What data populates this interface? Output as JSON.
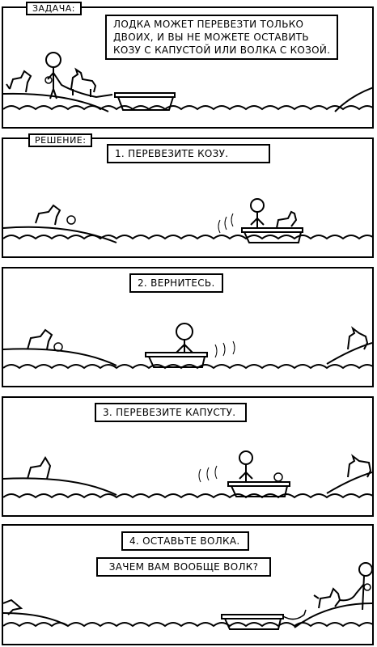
{
  "panels": [
    {
      "label": "ЗАДАЧА:",
      "caption_lines": [
        "ЛОДКА МОЖЕТ ПЕРЕВЕЗТИ ТОЛЬКО",
        "ДВОИХ, И ВЫ НЕ МОЖЕТЕ ОСТАВИТЬ",
        "КОЗУ С КАПУСТОЙ ИЛИ ВОЛКА С КОЗОЙ."
      ]
    },
    {
      "label": "РЕШЕНИЕ:",
      "caption": "1. ПЕРЕВЕЗИТЕ КОЗУ."
    },
    {
      "caption": "2. ВЕРНИТЕСЬ."
    },
    {
      "caption": "3. ПЕРЕВЕЗИТЕ КАПУСТУ."
    },
    {
      "caption": "4. ОСТАВЬТЕ ВОЛКА.",
      "caption2": "ЗАЧЕМ ВАМ ВООБЩЕ ВОЛК?"
    }
  ]
}
